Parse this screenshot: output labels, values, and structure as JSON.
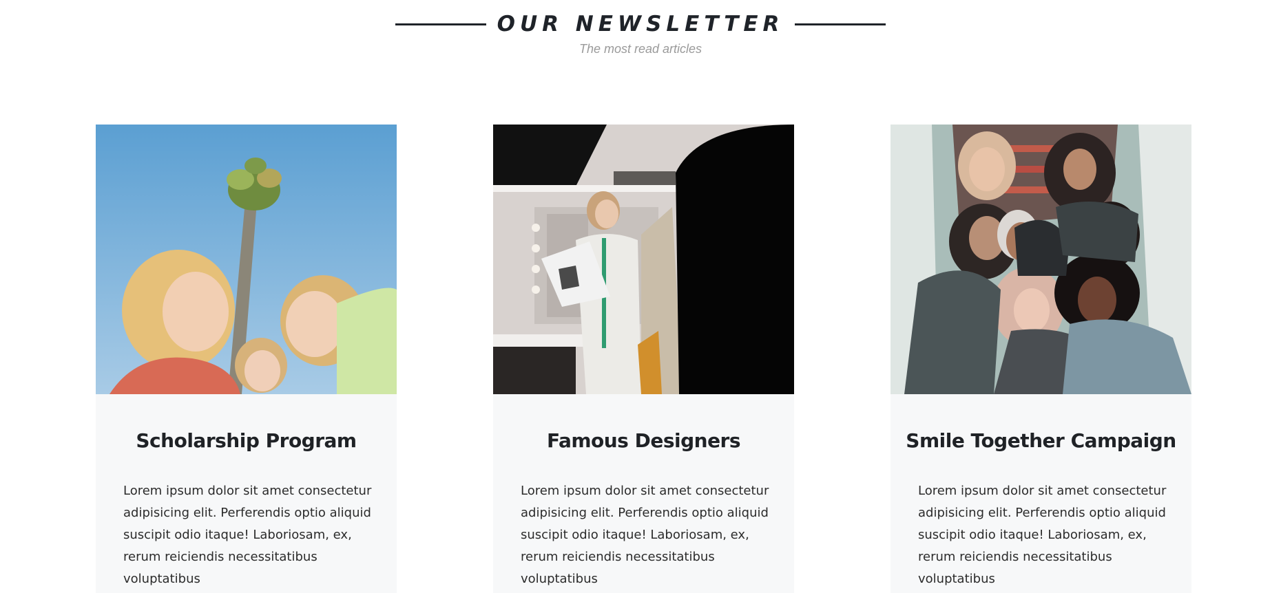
{
  "section": {
    "title": "OUR NEWSLETTER",
    "subtitle": "The most read articles"
  },
  "cards": [
    {
      "title": "Scholarship Program",
      "text": "Lorem ipsum dolor sit amet consectetur adipisicing elit. Perferendis optio aliquid suscipit odio itaque! Laboriosam, ex, rerum reiciendis necessitatibus voluptatibus",
      "image": "three-girls-under-palm-tree-photo"
    },
    {
      "title": "Famous Designers",
      "text": "Lorem ipsum dolor sit amet consectetur adipisicing elit. Perferendis optio aliquid suscipit odio itaque! Laboriosam, ex, rerum reiciendis necessitatibus voluptatibus",
      "image": "designer-reading-sketches-photo"
    },
    {
      "title": "Smile Together Campaign",
      "text": "Lorem ipsum dolor sit amet consectetur adipisicing elit. Perferendis optio aliquid suscipit odio itaque! Laboriosam, ex, rerum reiciendis necessitatibus voluptatibus",
      "image": "group-of-women-on-stairs-photo"
    }
  ],
  "colors": {
    "heading": "#1f2329",
    "subtitle": "#9a9a9a",
    "card_background": "#f7f8f9",
    "body_text": "#2b2b2b"
  }
}
